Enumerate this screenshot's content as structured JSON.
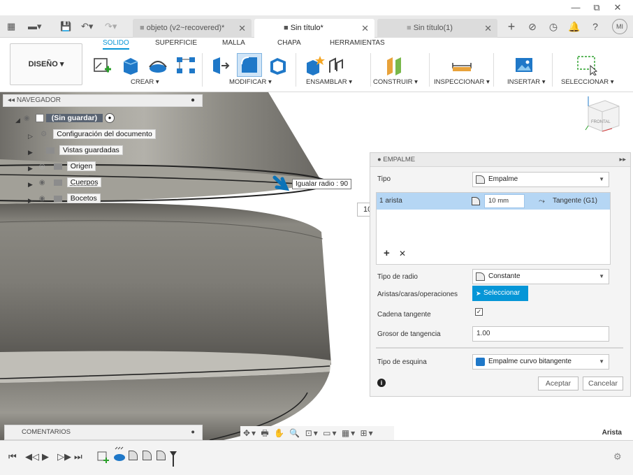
{
  "window": {
    "minimize": "—",
    "restore": "⧉",
    "close": "✕"
  },
  "tabs": [
    {
      "label": "objeto (v2~recovered)*",
      "active": false
    },
    {
      "label": "Sin título*",
      "active": true
    },
    {
      "label": "Sin título(1)",
      "active": false
    }
  ],
  "user_badge": "MI",
  "ribbon": {
    "workspace": "DISEÑO ▾",
    "tabs": [
      "SOLIDO",
      "SUPERFICIE",
      "MALLA",
      "CHAPA",
      "HERRAMIENTAS"
    ],
    "groups": [
      "CREAR ▾",
      "MODIFICAR ▾",
      "ENSAMBLAR ▾",
      "CONSTRUIR ▾",
      "INSPECCIONAR ▾",
      "INSERTAR ▾",
      "SELECCIONAR ▾"
    ]
  },
  "navigator": {
    "title": "NAVEGADOR",
    "root": "(Sin guardar)",
    "items": [
      "Configuración del documento",
      "Vistas guardadas",
      "Origen",
      "Cuerpos",
      "Bocetos"
    ]
  },
  "viewcube_label": "FRONTAL",
  "tooltip": "Igualar radio : 90",
  "input_value": "10",
  "panel": {
    "title": "EMPALME",
    "tipo_label": "Tipo",
    "tipo_value": "Empalme",
    "edge_label": "1 arista",
    "radius": "10 mm",
    "continuity": "Tangente (G1)",
    "add": "+",
    "remove": "✕",
    "radius_type_label": "Tipo de radio",
    "radius_type_value": "Constante",
    "aristas_label": "Aristas/caras/operaciones",
    "select_btn": "Seleccionar",
    "chain_label": "Cadena tangente",
    "chain_checked": "✓",
    "tangency_label": "Grosor de tangencia",
    "tangency_value": "1.00",
    "corner_label": "Tipo de esquina",
    "corner_value": "Empalme curvo bitangente",
    "ok": "Aceptar",
    "cancel": "Cancelar"
  },
  "comments": "COMENTARIOS",
  "status_text": "Arista",
  "accent": "#0696d7"
}
